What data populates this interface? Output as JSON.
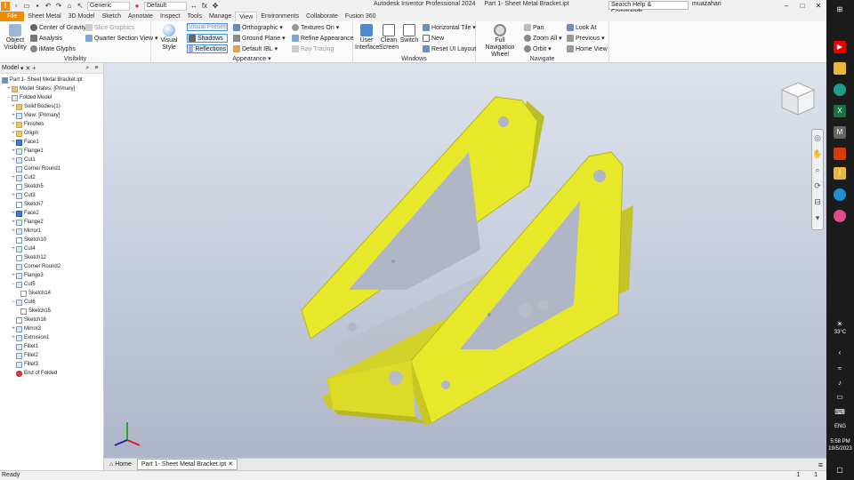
{
  "qat": {
    "appearance": "Generic",
    "material": "Default",
    "fx": "fx"
  },
  "title": {
    "app": "Autodesk Inventor Professional 2024",
    "doc": "Part 1- Sheet Metal Bracket.ipt"
  },
  "search": {
    "placeholder": "Search Help & Commands..."
  },
  "user": {
    "name": "muazahari"
  },
  "tabs": [
    "File",
    "Sheet Metal",
    "3D Model",
    "Sketch",
    "Annotate",
    "Inspect",
    "Tools",
    "Manage",
    "View",
    "Environments",
    "Collaborate",
    "Fusion 360"
  ],
  "ribbon": {
    "visibility": {
      "label": "Visibility",
      "object_visibility": "Object Visibility",
      "center_gravity": "Center of Gravity",
      "analysis": "Analysis",
      "imate": "iMate Glyphs",
      "slice": "Slice Graphics",
      "quarter": "Quarter Section View"
    },
    "appearance": {
      "label": "Appearance",
      "visual_style": "Visual Style",
      "visual_presets": "Visual Presets",
      "shadows": "Shadows",
      "reflections": "Reflections",
      "orthographic": "Orthographic",
      "ground_plane": "Ground Plane",
      "default_ibl": "Default IBL",
      "textures": "Textures On",
      "refine": "Refine Appearance",
      "ray_tracing": "Ray Tracing"
    },
    "windows": {
      "label": "Windows",
      "user_interface": "User Interface",
      "clean_screen": "Clean Screen",
      "switch": "Switch",
      "horizontal_tile": "Horizontal Tile",
      "new": "New",
      "reset_ui": "Reset UI Layout"
    },
    "navigate": {
      "label": "Navigate",
      "full_nav": "Full Navigation Wheel",
      "pan": "Pan",
      "zoom_all": "Zoom All",
      "orbit": "Orbit",
      "look_at": "Look At",
      "previous": "Previous",
      "home_view": "Home View"
    }
  },
  "browser": {
    "tab": "Model",
    "root": "Part 1- Sheet Metal Bracket.ipt",
    "items": [
      {
        "label": "Model States: [Primary]",
        "depth": 1,
        "icon": "folder",
        "exp": "+"
      },
      {
        "label": "Folded Model",
        "depth": 1,
        "icon": "part",
        "exp": "−"
      },
      {
        "label": "Solid Bodies(1)",
        "depth": 2,
        "icon": "folder",
        "exp": "+"
      },
      {
        "label": "View: [Primary]",
        "depth": 2,
        "icon": "part",
        "exp": "+"
      },
      {
        "label": "Finishes",
        "depth": 2,
        "icon": "folder",
        "exp": "+"
      },
      {
        "label": "Origin",
        "depth": 2,
        "icon": "folder",
        "exp": "+"
      },
      {
        "label": "Face1",
        "depth": 2,
        "icon": "face",
        "exp": "+"
      },
      {
        "label": "Flange1",
        "depth": 2,
        "icon": "part",
        "exp": "+"
      },
      {
        "label": "Cut1",
        "depth": 2,
        "icon": "part",
        "exp": "+"
      },
      {
        "label": "Corner Round1",
        "depth": 2,
        "icon": "part",
        "exp": ""
      },
      {
        "label": "Cut2",
        "depth": 2,
        "icon": "part",
        "exp": "+"
      },
      {
        "label": "Sketch5",
        "depth": 2,
        "icon": "sk",
        "exp": ""
      },
      {
        "label": "Cut3",
        "depth": 2,
        "icon": "part",
        "exp": "+"
      },
      {
        "label": "Sketch7",
        "depth": 2,
        "icon": "sk",
        "exp": ""
      },
      {
        "label": "Face2",
        "depth": 2,
        "icon": "face",
        "exp": "+"
      },
      {
        "label": "Flange2",
        "depth": 2,
        "icon": "part",
        "exp": "+"
      },
      {
        "label": "Mirror1",
        "depth": 2,
        "icon": "part",
        "exp": "+"
      },
      {
        "label": "Sketch10",
        "depth": 2,
        "icon": "sk",
        "exp": ""
      },
      {
        "label": "Cut4",
        "depth": 2,
        "icon": "part",
        "exp": "+"
      },
      {
        "label": "Sketch12",
        "depth": 2,
        "icon": "sk",
        "exp": ""
      },
      {
        "label": "Corner Round2",
        "depth": 2,
        "icon": "part",
        "exp": ""
      },
      {
        "label": "Flange3",
        "depth": 2,
        "icon": "part",
        "exp": "+"
      },
      {
        "label": "Cut5",
        "depth": 2,
        "icon": "part",
        "exp": "−"
      },
      {
        "label": "Sketch14",
        "depth": 3,
        "icon": "sk",
        "exp": ""
      },
      {
        "label": "Cut6",
        "depth": 2,
        "icon": "part",
        "exp": "−"
      },
      {
        "label": "Sketch15",
        "depth": 3,
        "icon": "sk",
        "exp": ""
      },
      {
        "label": "Sketch16",
        "depth": 2,
        "icon": "sk",
        "exp": ""
      },
      {
        "label": "Mirror3",
        "depth": 2,
        "icon": "part",
        "exp": "+"
      },
      {
        "label": "Extrusion1",
        "depth": 2,
        "icon": "part",
        "exp": "+"
      },
      {
        "label": "Fillet1",
        "depth": 2,
        "icon": "part",
        "exp": ""
      },
      {
        "label": "Fillet2",
        "depth": 2,
        "icon": "part",
        "exp": ""
      },
      {
        "label": "Fillet3",
        "depth": 2,
        "icon": "part",
        "exp": ""
      },
      {
        "label": "End of Folded",
        "depth": 2,
        "icon": "err",
        "exp": ""
      }
    ]
  },
  "viewtabs": {
    "home": "Home",
    "doc": "Part 1- Sheet Metal Bracket.ipt"
  },
  "status": {
    "text": "Ready",
    "a": "1",
    "b": "1"
  },
  "tray": {
    "temp": "33°C",
    "lang": "ENG",
    "time": "5:58 PM",
    "date": "19/5/2023"
  },
  "colors": {
    "part": "#e8e82a",
    "file_tab": "#ef8b00"
  }
}
